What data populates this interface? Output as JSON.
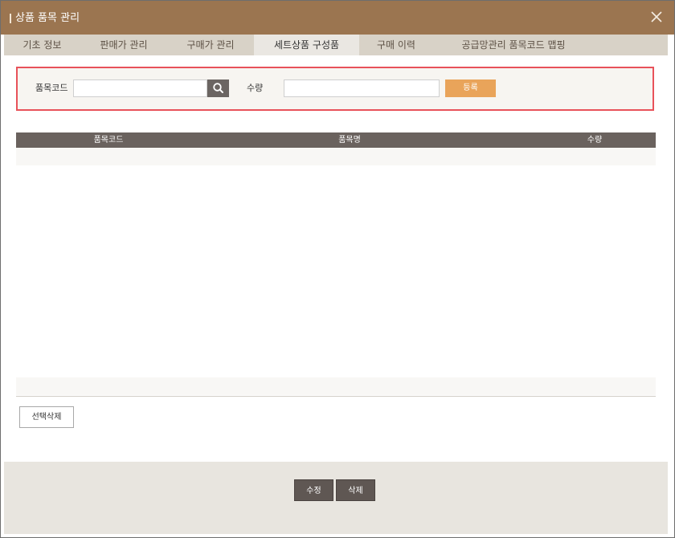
{
  "title": "상품 품목 관리",
  "tabs": [
    {
      "label": "기초 정보"
    },
    {
      "label": "판매가 관리"
    },
    {
      "label": "구매가 관리"
    },
    {
      "label": "세트상품 구성품"
    },
    {
      "label": "구매 이력"
    },
    {
      "label": "공급망관리 품목코드 맵핑"
    }
  ],
  "active_tab": "세트상품 구성품",
  "form": {
    "item_code_label": "품목코드",
    "item_code_value": "",
    "quantity_label": "수량",
    "quantity_value": "",
    "register_label": "등록"
  },
  "grid": {
    "columns": [
      "품목코드",
      "품목명",
      "수량"
    ],
    "rows": []
  },
  "select_delete_label": "선택삭제",
  "footer": {
    "edit_label": "수정",
    "delete_label": "삭제"
  },
  "colors": {
    "titlebar": "#9b7550",
    "accent_button": "#e9a45a",
    "highlight_border": "#e8525a",
    "grid_header": "#6a625e"
  },
  "icons": {
    "close": "close-icon",
    "search": "search-icon"
  }
}
